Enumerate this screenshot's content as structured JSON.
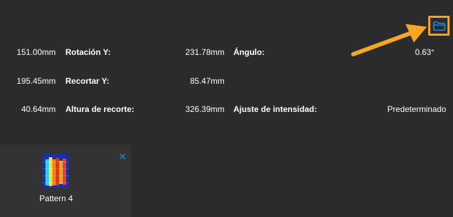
{
  "rows": [
    {
      "left_value": "151.00mm",
      "label_1": "Rotación Y:",
      "value_1": "231.78mm",
      "label_2": "Ángulo:",
      "value_2": "0.63°"
    },
    {
      "left_value": "195.45mm",
      "label_1": "Recortar Y:",
      "value_1": "85.47mm",
      "label_2": "",
      "value_2": ""
    },
    {
      "left_value": "40.64mm",
      "label_1": "Altura de recorte:",
      "value_1": "326.39mm",
      "label_2": "Ajuste de intensidad:",
      "value_2": "Predeterminado"
    }
  ],
  "pattern": {
    "label": "Pattern 4",
    "close_icon": "×"
  },
  "icons": {
    "folder": "folder-icon",
    "arrow": "arrow-icon"
  },
  "colors": {
    "background": "#2b2b2b",
    "highlight": "#f5a623",
    "accent": "#1e8fd8"
  }
}
